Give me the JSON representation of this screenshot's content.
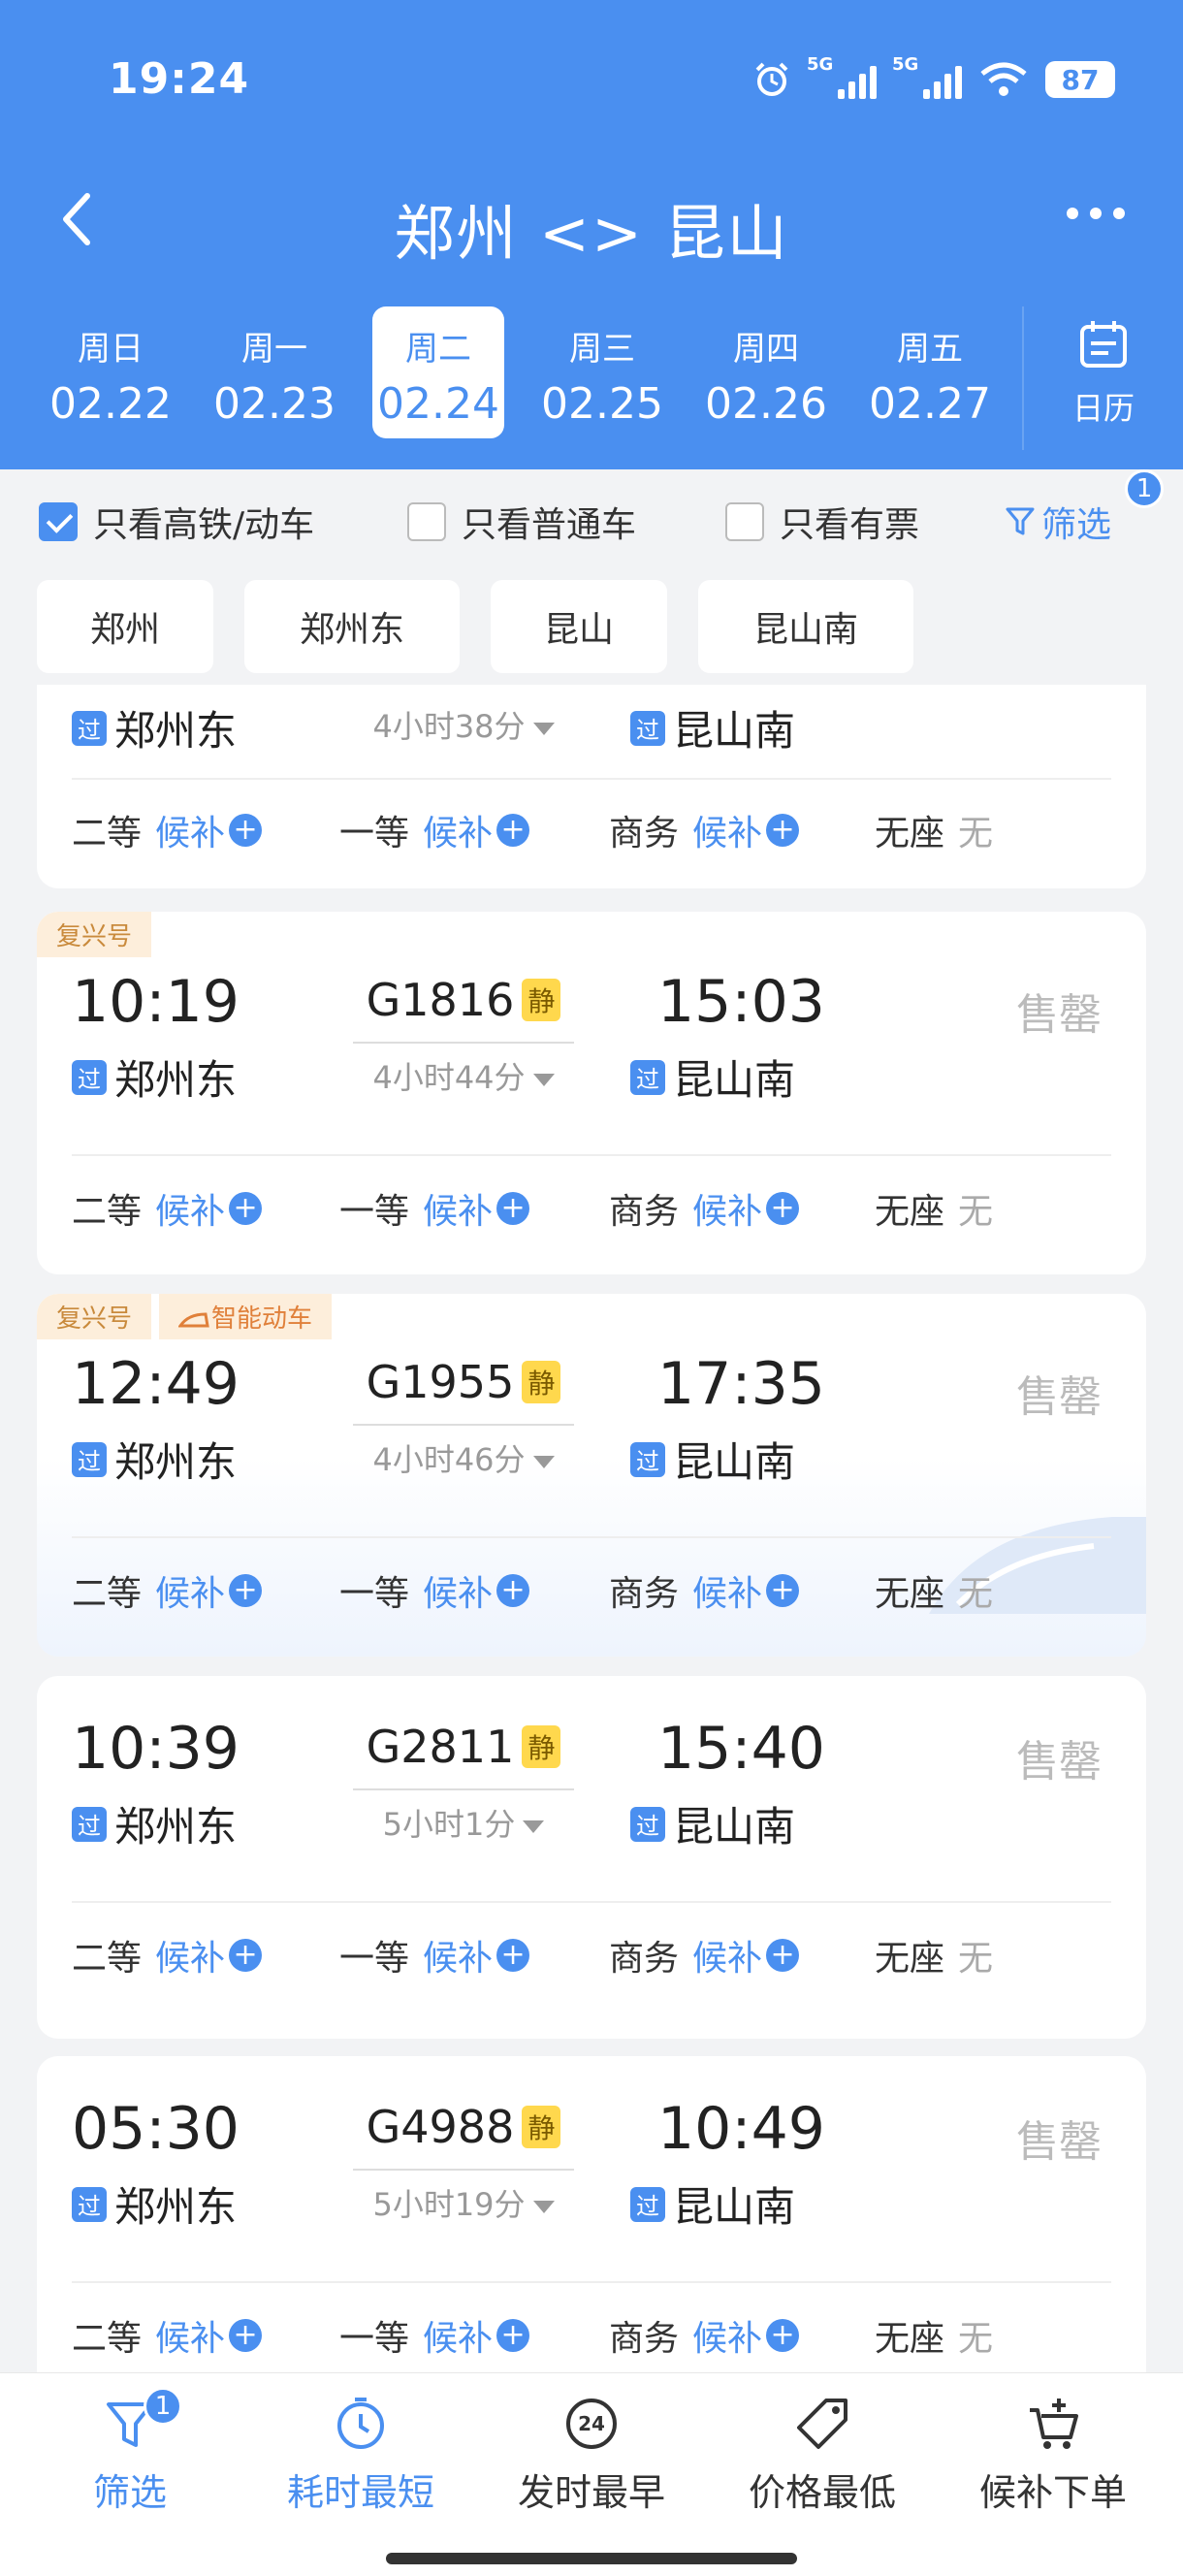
{
  "status": {
    "time": "19:24",
    "signal1": "5G",
    "signal2": "5G",
    "battery": "87"
  },
  "header": {
    "title": "郑州 <> 昆山",
    "calendar_label": "日历"
  },
  "dates": [
    {
      "weekday": "周日",
      "date": "02.22"
    },
    {
      "weekday": "周一",
      "date": "02.23"
    },
    {
      "weekday": "周二",
      "date": "02.24",
      "active": true
    },
    {
      "weekday": "周三",
      "date": "02.25"
    },
    {
      "weekday": "周四",
      "date": "02.26"
    },
    {
      "weekday": "周五",
      "date": "02.27"
    }
  ],
  "filters": {
    "high_speed": "只看高铁/动车",
    "regular": "只看普通车",
    "available": "只看有票",
    "filter_label": "筛选",
    "filter_badge": "1"
  },
  "stations": [
    "郑州",
    "郑州东",
    "昆山",
    "昆山南"
  ],
  "seat_labels": {
    "second": "二等",
    "first": "一等",
    "business": "商务",
    "no_seat": "无座"
  },
  "seat_status": {
    "waitlist": "候补",
    "none": "无"
  },
  "pass_label": "过",
  "trains": [
    {
      "tags": [],
      "depart_time": "",
      "arrive_time": "",
      "train_no": "",
      "duration": "4小时38分",
      "from": "郑州东",
      "to": "昆山南",
      "status": ""
    },
    {
      "tags": [
        "复兴号"
      ],
      "depart_time": "10:19",
      "arrive_time": "15:03",
      "train_no": "G1816",
      "quiet": "静",
      "duration": "4小时44分",
      "from": "郑州东",
      "to": "昆山南",
      "status": "售罄"
    },
    {
      "tags": [
        "复兴号",
        "智能动车"
      ],
      "depart_time": "12:49",
      "arrive_time": "17:35",
      "train_no": "G1955",
      "quiet": "静",
      "duration": "4小时46分",
      "from": "郑州东",
      "to": "昆山南",
      "status": "售罄"
    },
    {
      "tags": [],
      "depart_time": "10:39",
      "arrive_time": "15:40",
      "train_no": "G2811",
      "quiet": "静",
      "duration": "5小时1分",
      "from": "郑州东",
      "to": "昆山南",
      "status": "售罄"
    },
    {
      "tags": [],
      "depart_time": "05:30",
      "arrive_time": "10:49",
      "train_no": "G4988",
      "quiet": "静",
      "duration": "5小时19分",
      "from": "郑州东",
      "to": "昆山南",
      "status": "售罄"
    }
  ],
  "bottom_nav": [
    {
      "label": "筛选",
      "icon": "filter-icon",
      "badge": "1",
      "active": true
    },
    {
      "label": "耗时最短",
      "icon": "timer-icon",
      "active": true
    },
    {
      "label": "发时最早",
      "icon": "clock-24-icon",
      "clock_text": "24"
    },
    {
      "label": "价格最低",
      "icon": "price-tag-icon"
    },
    {
      "label": "候补下单",
      "icon": "cart-add-icon"
    }
  ],
  "colors": {
    "brand": "#4a8ff0",
    "sold_out": "#bbbbbb",
    "tag_bg": "#fdeedb",
    "tag_text": "#c98a3c",
    "quiet_badge": "#ffd84d"
  }
}
